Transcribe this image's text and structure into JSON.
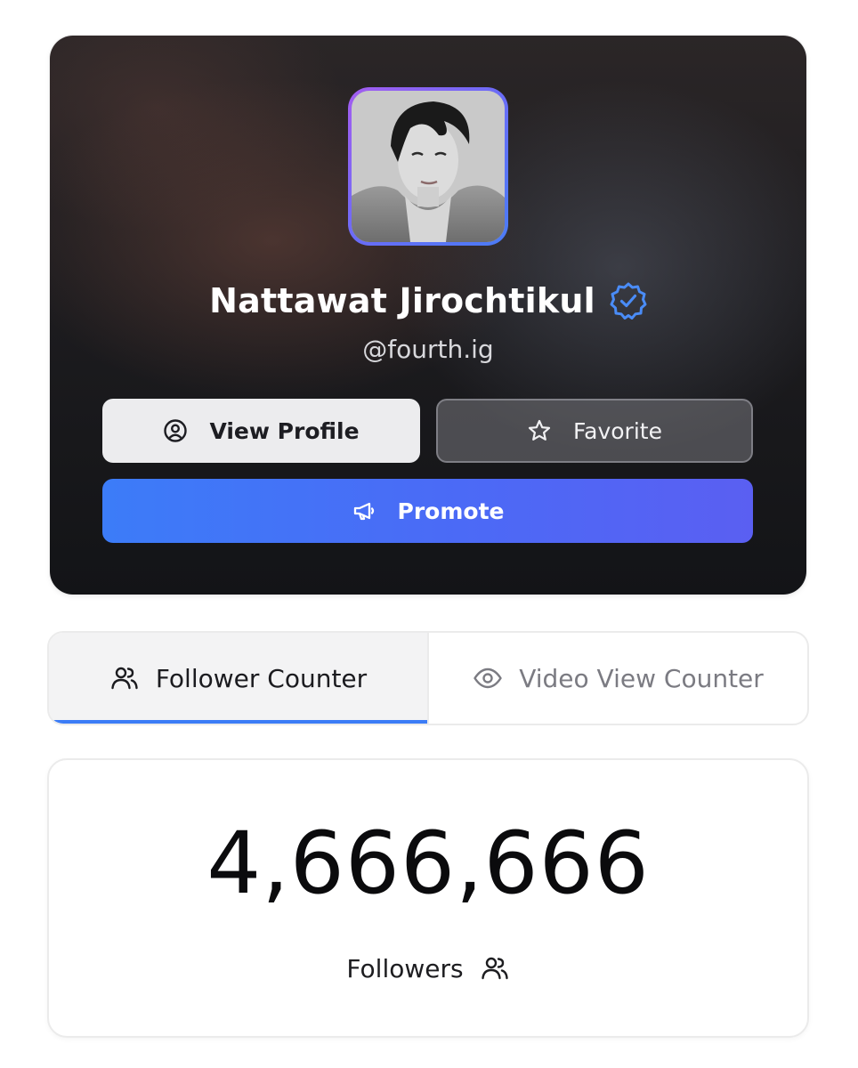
{
  "profile": {
    "name": "Nattawat Jirochtikul",
    "handle": "@fourth.ig",
    "verified": true,
    "avatar_icon": "profile-photo",
    "accent_border": [
      "#a45cf0",
      "#4a7cf6"
    ]
  },
  "actions": {
    "view_profile_label": "View Profile",
    "view_profile_icon": "user-circle-icon",
    "favorite_label": "Favorite",
    "favorite_icon": "star-icon",
    "promote_label": "Promote",
    "promote_icon": "megaphone-icon",
    "promote_color": "#3c7cf8"
  },
  "tabs": [
    {
      "label": "Follower Counter",
      "icon": "users-icon",
      "active": true
    },
    {
      "label": "Video View Counter",
      "icon": "eye-icon",
      "active": false
    }
  ],
  "counter": {
    "value": "4,666,666",
    "label": "Followers",
    "icon": "users-icon"
  },
  "colors": {
    "accent": "#3b7cf6",
    "verified": "#4a8cf7"
  }
}
